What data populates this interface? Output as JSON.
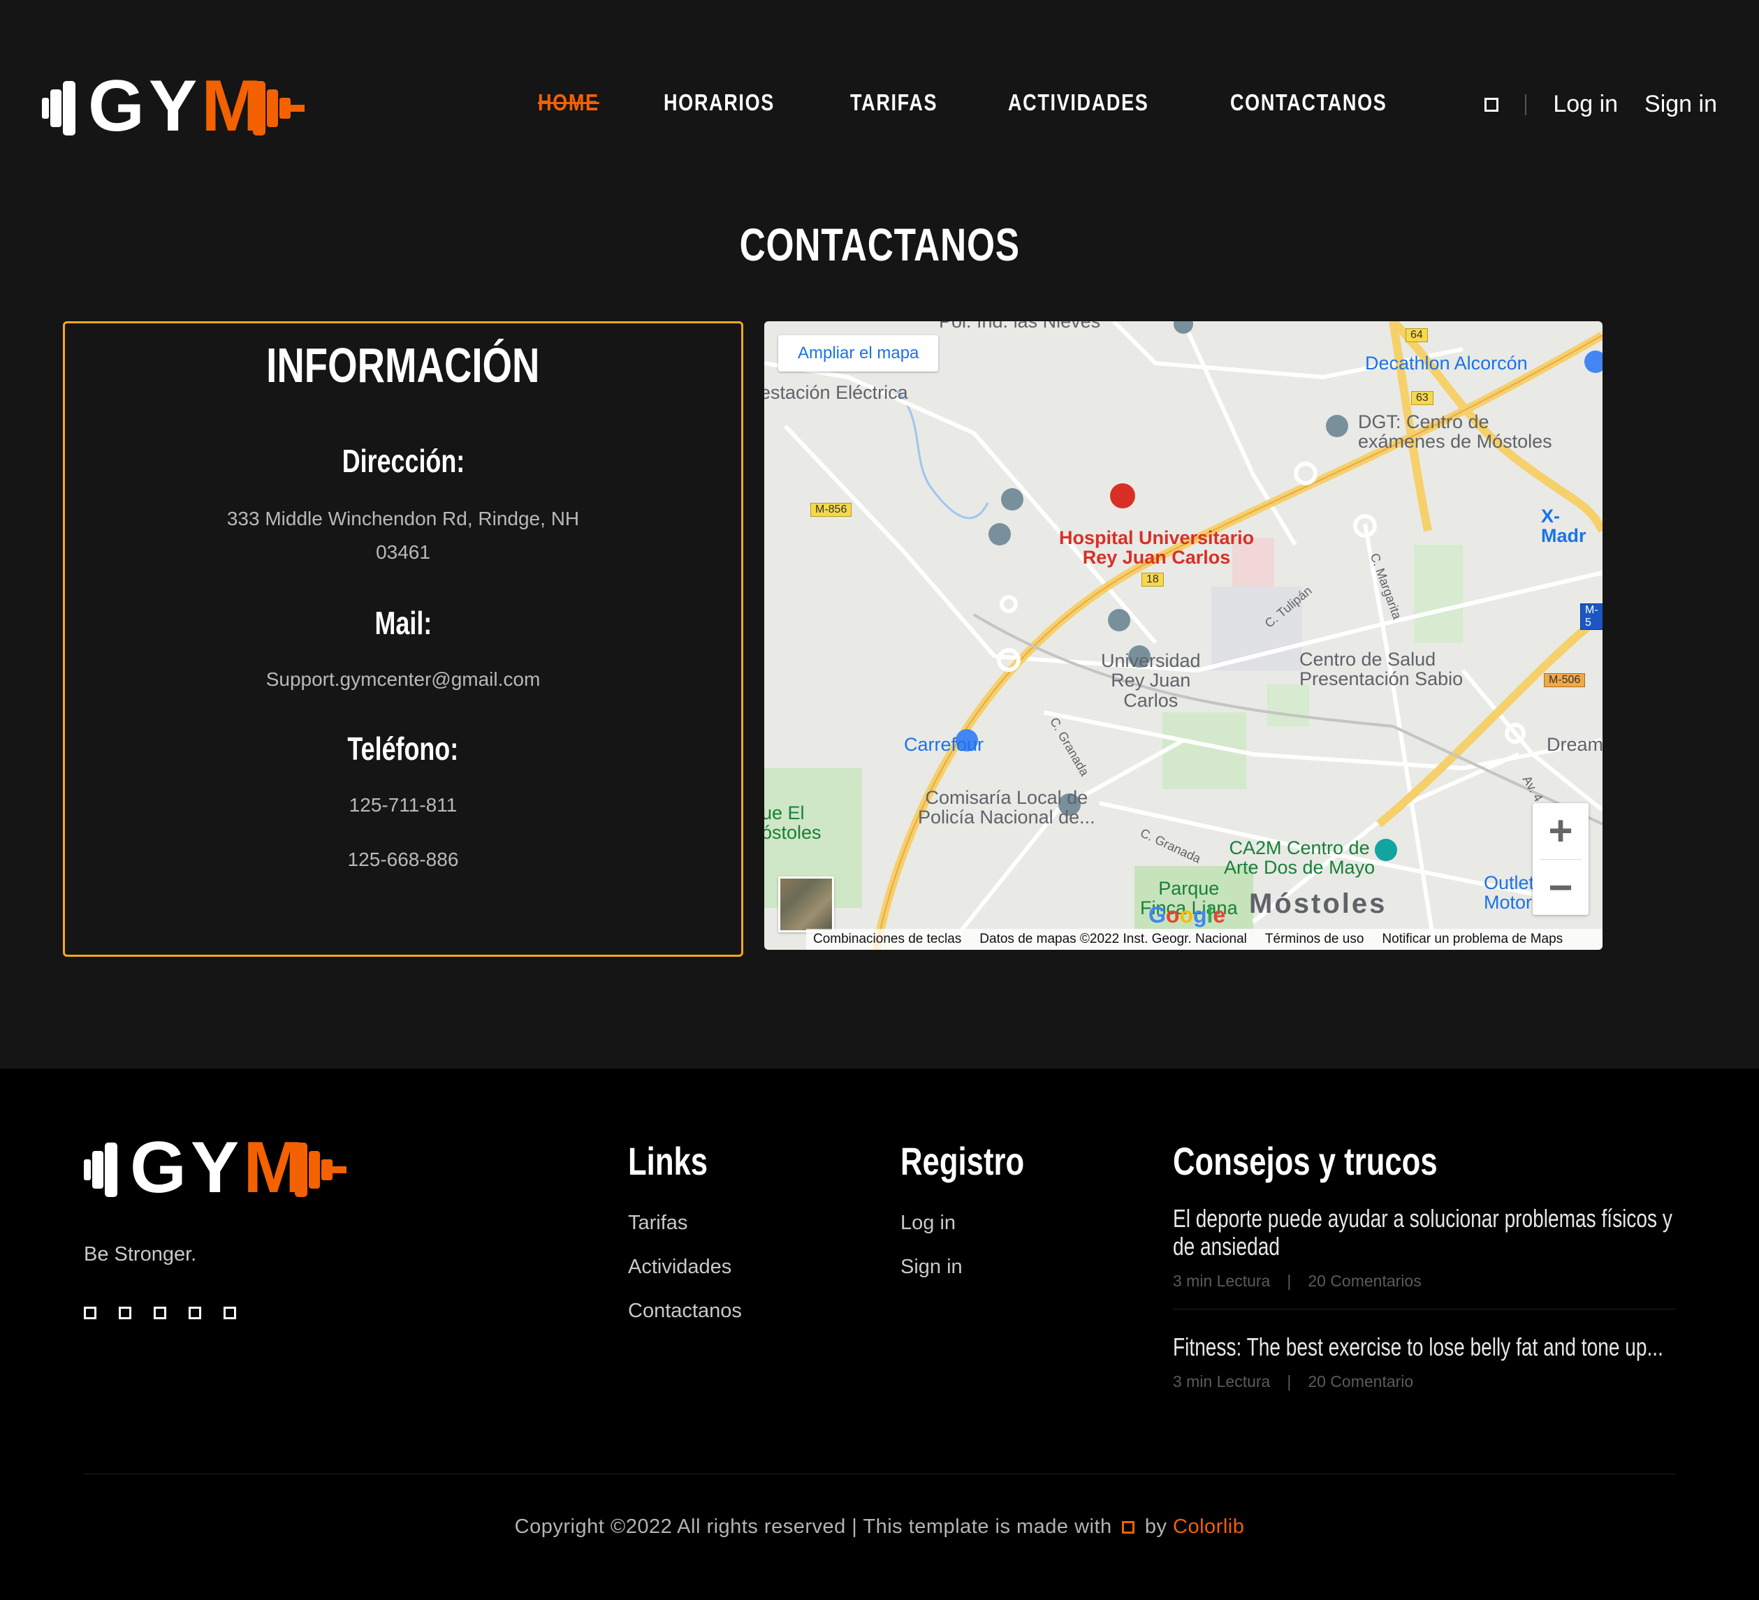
{
  "header": {
    "logo": {
      "left": "GY",
      "right": "M"
    },
    "nav": [
      {
        "label": "HOME",
        "active": true
      },
      {
        "label": "HORARIOS"
      },
      {
        "label": "TARIFAS"
      },
      {
        "label": "ACTIVIDADES"
      },
      {
        "label": "CONTACTANOS"
      }
    ],
    "login": "Log in",
    "signin": "Sign in"
  },
  "page": {
    "title": "CONTACTANOS"
  },
  "info": {
    "title": "INFORMACIÓN",
    "address_label": "Dirección:",
    "address": "333 Middle Winchendon Rd, Rindge, NH 03461",
    "mail_label": "Mail:",
    "mail": "Support.gymcenter@gmail.com",
    "phone_label": "Teléfono:",
    "phones": [
      "125-711-811",
      "125-668-886"
    ]
  },
  "map": {
    "expand": "Ampliar el mapa",
    "labels": {
      "estacion": "estación Eléctrica",
      "pol": "Pol. Ind. las Nieves",
      "decathlon": "Decathlon Alcorcón",
      "dgt": "DGT: Centro de\nexámenes de Móstoles",
      "xmad": "X-Madr",
      "hospital": "Hospital Universitario\nRey Juan Carlos",
      "tulipan": "C. Tulipán",
      "margarita": "C. Margarita",
      "universidad": "Universidad\nRey Juan\nCarlos",
      "centro_salud": "Centro de Salud\nPresentación Sabio",
      "carrefour": "Carrefour",
      "granada1": "C. Granada",
      "dream": "Dream",
      "comisaria": "Comisaría Local de\nPolicía Nacional de...",
      "granada2": "C. Granada",
      "ca2m": "CA2M Centro de\nArte Dos de Mayo",
      "parque": "Parque\nFinca Liana",
      "city": "Móstoles",
      "outlet": "Outlet\nMotor",
      "ueel": "ue El\nóstoles",
      "av": "Av. 4"
    },
    "shields": {
      "m856": "M-856",
      "r64": "64",
      "r63": "63",
      "r18": "18",
      "m506": "M-506",
      "m5": "M-5"
    },
    "google": "Google",
    "footer": [
      "Combinaciones de teclas",
      "Datos de mapas ©2022 Inst. Geogr. Nacional",
      "Términos de uso",
      "Notificar un problema de Maps"
    ]
  },
  "footer": {
    "logo": {
      "left": "GY",
      "right": "M"
    },
    "tagline": "Be Stronger.",
    "links_title": "Links",
    "links": [
      "Tarifas",
      "Actividades",
      "Contactanos"
    ],
    "registro_title": "Registro",
    "registro": [
      "Log in",
      "Sign in"
    ],
    "tips_title": "Consejos y trucos",
    "tips": [
      {
        "title": "El deporte puede ayudar a solucionar problemas físicos y de ansiedad",
        "read": "3 min Lectura",
        "comments": "20 Comentarios"
      },
      {
        "title": "Fitness: The best exercise to lose belly fat and tone up...",
        "read": "3 min Lectura",
        "comments": "20 Comentario"
      }
    ],
    "copyright_pre": "Copyright ©2022 All rights reserved | This template is made with",
    "copyright_by": "by",
    "brand": "Colorlib"
  }
}
